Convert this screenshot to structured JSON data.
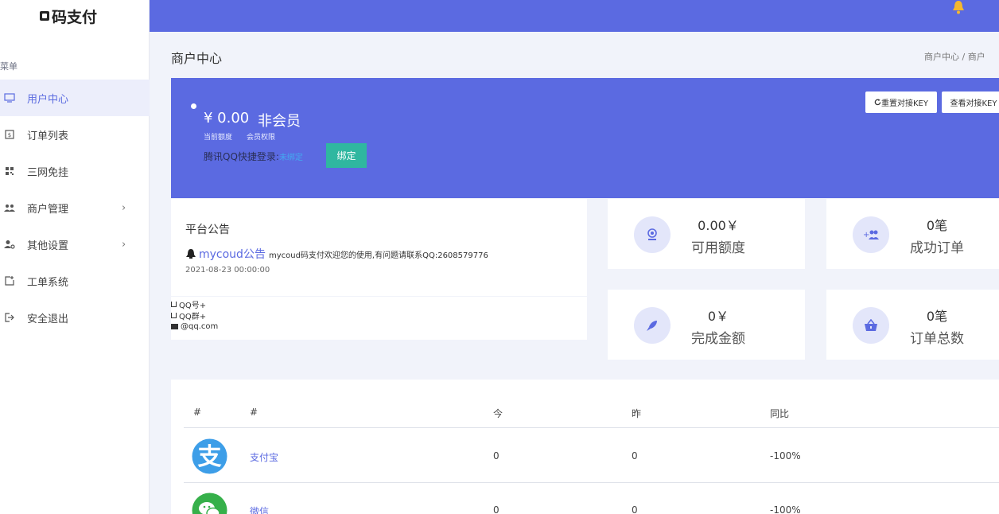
{
  "sidebar": {
    "logo": "码支付",
    "menu_title": "菜单",
    "items": [
      {
        "label": "用户中心",
        "icon": "monitor-icon"
      },
      {
        "label": "订单列表",
        "icon": "list-icon"
      },
      {
        "label": "三网免挂",
        "icon": "qrcode-icon"
      },
      {
        "label": "商户管理",
        "icon": "users-icon"
      },
      {
        "label": "其他设置",
        "icon": "user-settings-icon"
      },
      {
        "label": "工单系统",
        "icon": "ticket-icon"
      },
      {
        "label": "安全退出",
        "icon": "logout-icon"
      }
    ],
    "chevron": "›"
  },
  "header": {
    "page_title": "商户中心",
    "breadcrumb": "商户中心 / 商户"
  },
  "banner": {
    "balance": "¥ 0.00",
    "member": "非会员",
    "balance_label": "当前额度",
    "member_label": "会员权限",
    "qq_login": "腾讯QQ快捷登录:",
    "qq_status": "未绑定",
    "bind_button": "绑定",
    "reset_key_button": "重置对接KEY",
    "view_key_button": "查看对接KEY"
  },
  "notice": {
    "title": "平台公告",
    "source": "mycoud公告",
    "message": "mycoud码支付欢迎您的使用,有问题请联系QQ:2608579776",
    "date": "2021-08-23 00:00:00"
  },
  "contact": {
    "qq": "QQ号+",
    "qq_group": "QQ群+",
    "email": "@qq.com"
  },
  "stats": [
    {
      "value": "0.00￥",
      "label": "可用额度",
      "icon": "webcam-icon"
    },
    {
      "value": "0笔",
      "label": "成功订单",
      "icon": "add-users-icon"
    },
    {
      "value": "0￥",
      "label": "完成金额",
      "icon": "rocket-icon"
    },
    {
      "value": "0笔",
      "label": "订单总数",
      "icon": "basket-icon"
    }
  ],
  "table": {
    "headers": [
      "#",
      "#",
      "今",
      "昨",
      "同比"
    ],
    "rows": [
      {
        "icon": "alipay-icon",
        "name": "支付宝",
        "today": "0",
        "yesterday": "0",
        "ratio": "-100%"
      },
      {
        "icon": "wechat-icon",
        "name": "微信",
        "today": "0",
        "yesterday": "0",
        "ratio": "-100%"
      }
    ]
  },
  "colors": {
    "primary": "#5b6ae1",
    "teal": "#2fb7a0",
    "alipay": "#3d9ee8",
    "wechat": "#36b04a",
    "bell": "#f5b82e"
  }
}
